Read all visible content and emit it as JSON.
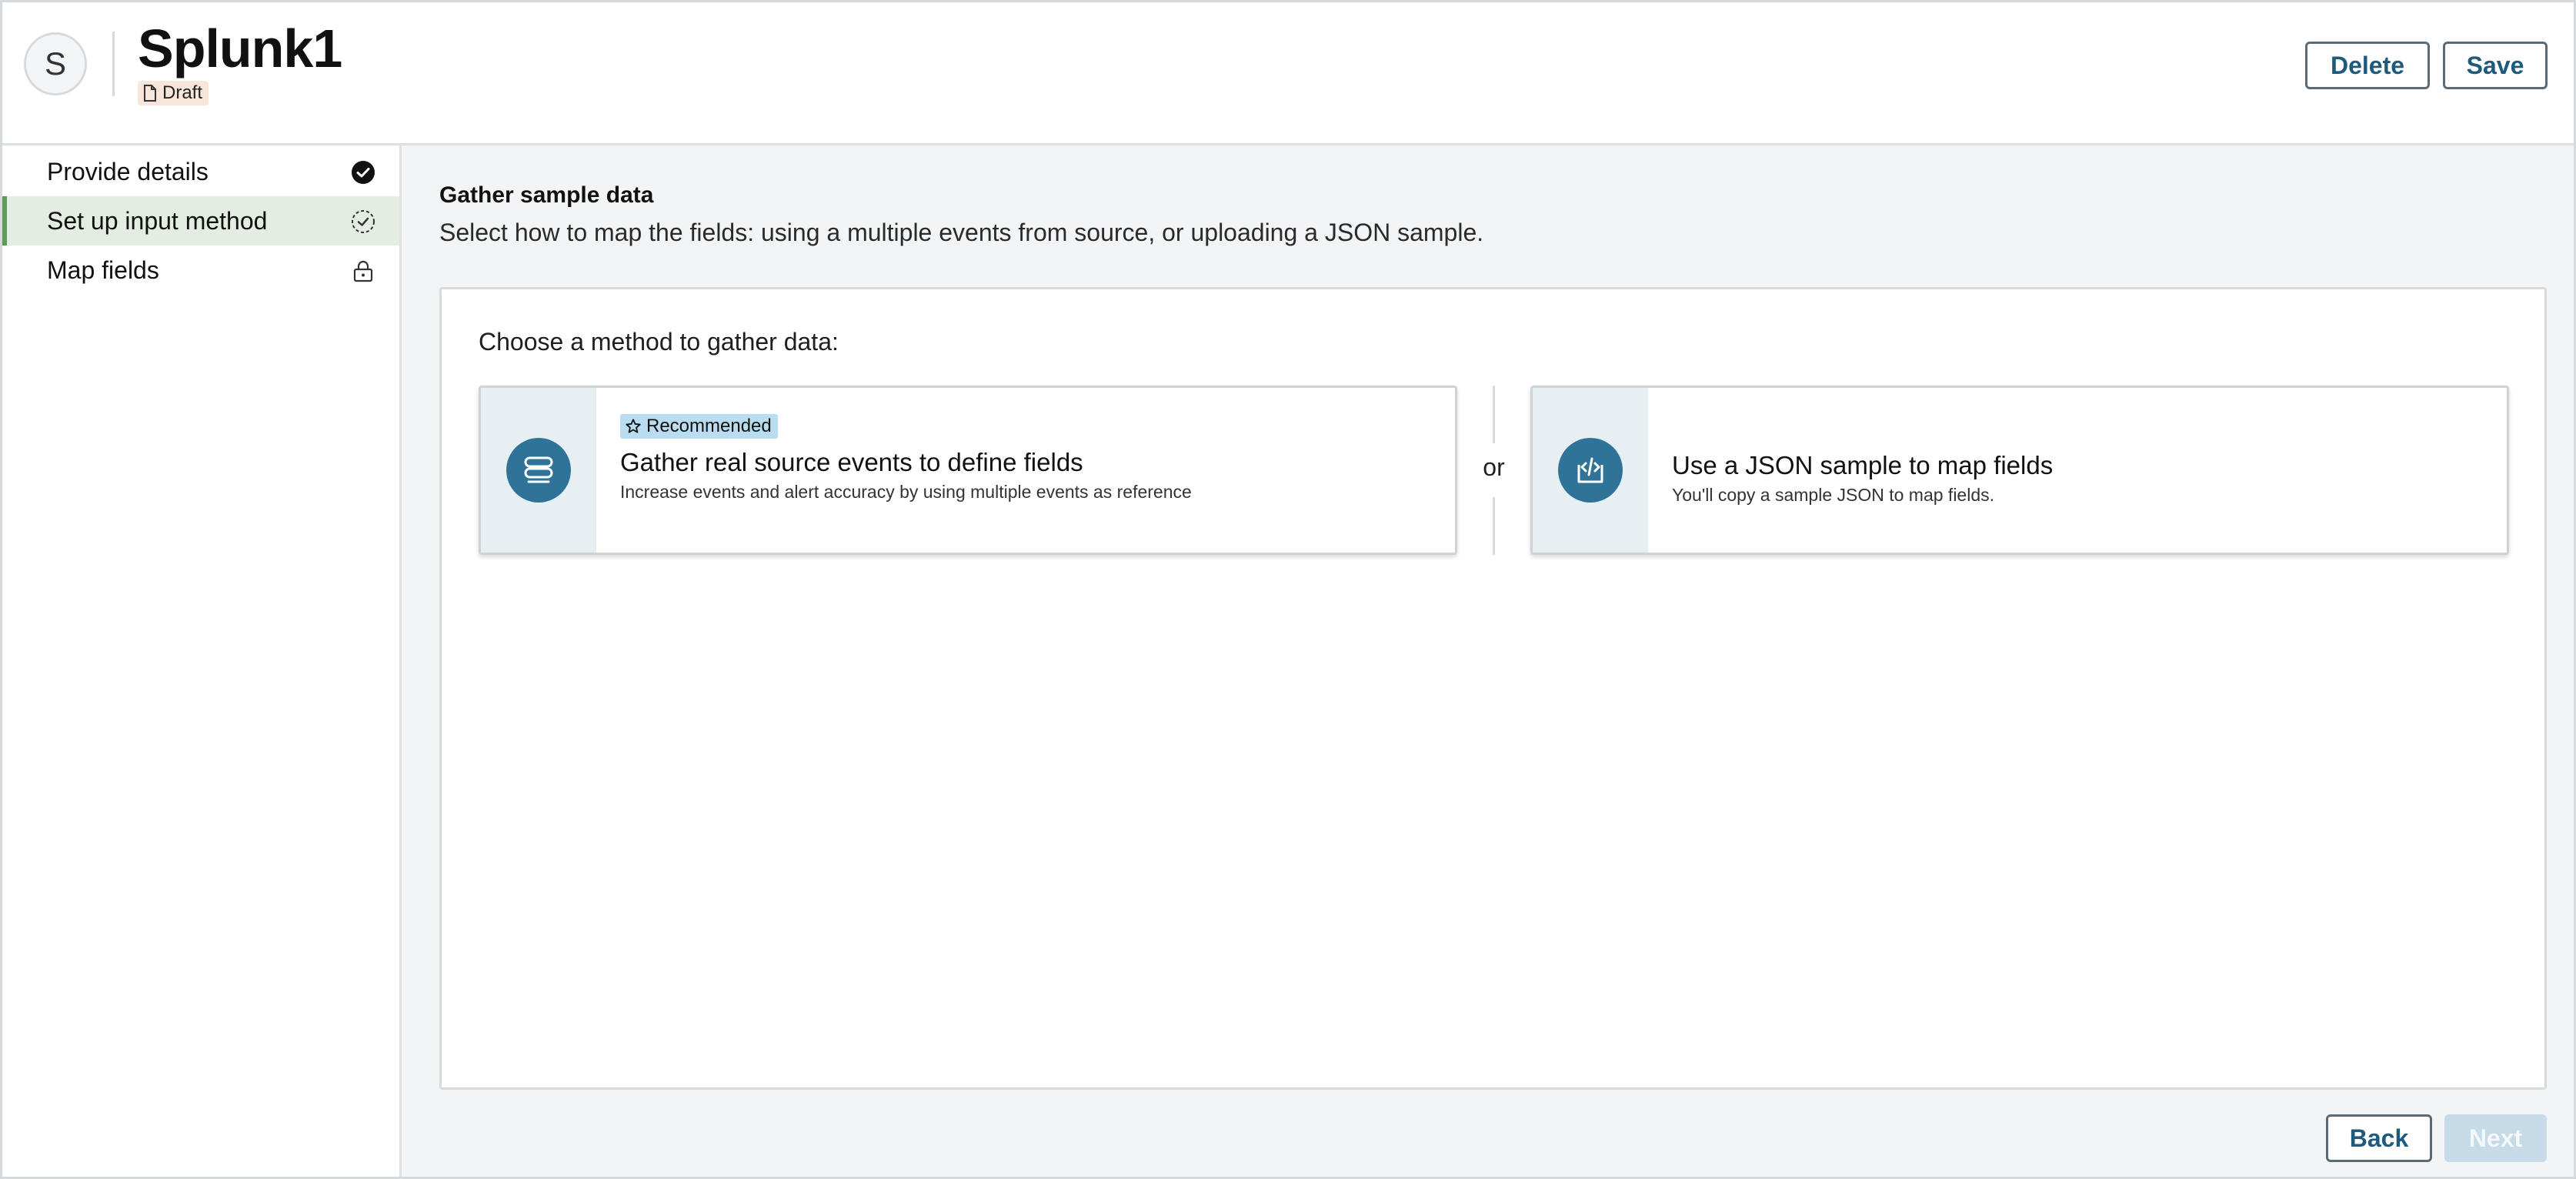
{
  "header": {
    "avatar_letter": "S",
    "title": "Splunk1",
    "status_badge": "Draft",
    "delete_label": "Delete",
    "save_label": "Save"
  },
  "sidebar": {
    "steps": [
      {
        "label": "Provide details",
        "state": "completed",
        "icon": "check-circle-icon"
      },
      {
        "label": "Set up input method",
        "state": "in-progress",
        "icon": "progress-check-icon"
      },
      {
        "label": "Map fields",
        "state": "locked",
        "icon": "lock-icon"
      }
    ]
  },
  "main": {
    "section_title": "Gather sample data",
    "section_description": "Select how to map the fields: using a multiple events from source, or uploading a JSON sample.",
    "panel_heading": "Choose a method to gather data:",
    "options": [
      {
        "badge": "Recommended",
        "title": "Gather real source events to define fields",
        "subtitle": "Increase events and alert accuracy by using multiple events as reference",
        "icon": "events-stack-icon"
      },
      {
        "title": "Use a JSON sample to map fields",
        "subtitle": "You'll copy a sample JSON to map fields.",
        "icon": "code-upload-icon"
      }
    ],
    "separator_text": "or",
    "back_label": "Back",
    "next_label": "Next"
  },
  "colors": {
    "accent": "#2f7498",
    "active_step_bg": "#e3ede1",
    "active_step_border": "#5f9a58",
    "draft_badge_bg": "#f7e6d9",
    "recommended_badge_bg": "#b9dcf0",
    "disabled_button_bg": "#c6dbe7"
  }
}
